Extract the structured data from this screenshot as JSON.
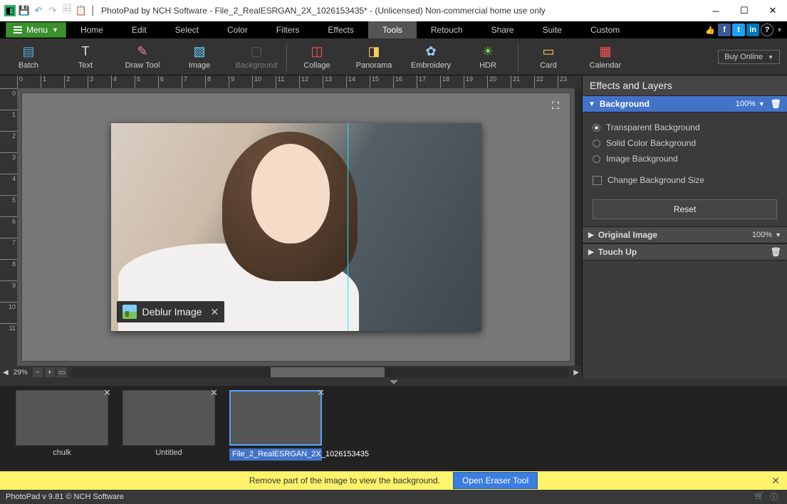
{
  "titlebar": {
    "title": "PhotoPad by NCH Software - File_2_RealESRGAN_2X_1026153435* - (Unlicensed) Non-commercial home use only"
  },
  "menu": {
    "button": "Menu",
    "items": [
      "Home",
      "Edit",
      "Select",
      "Color",
      "Filters",
      "Effects",
      "Tools",
      "Retouch",
      "Share",
      "Suite",
      "Custom"
    ],
    "active_index": 6
  },
  "toolbar": {
    "items": [
      {
        "label": "Batch",
        "icon": "batch-icon",
        "color": "#5ad"
      },
      {
        "label": "Text",
        "icon": "text-icon",
        "color": "#ddd"
      },
      {
        "label": "Draw Tool",
        "icon": "pencil-icon",
        "color": "#e8a"
      },
      {
        "label": "Image",
        "icon": "image-icon",
        "color": "#6cf"
      },
      {
        "label": "Background",
        "icon": "background-icon",
        "color": "#888",
        "disabled": true
      },
      {
        "label": "Collage",
        "icon": "collage-icon",
        "color": "#f55"
      },
      {
        "label": "Panorama",
        "icon": "panorama-icon",
        "color": "#fc5"
      },
      {
        "label": "Embroidery",
        "icon": "embroidery-icon",
        "color": "#9cf"
      },
      {
        "label": "HDR",
        "icon": "hdr-icon",
        "color": "#7d4"
      },
      {
        "label": "Card",
        "icon": "card-icon",
        "color": "#fc5"
      },
      {
        "label": "Calendar",
        "icon": "calendar-icon",
        "color": "#f55"
      }
    ],
    "buy": "Buy Online"
  },
  "canvas": {
    "zoom": "29%",
    "deblur_label": "Deblur Image"
  },
  "panel": {
    "title": "Effects and Layers",
    "sections": {
      "background": {
        "label": "Background",
        "percent": "100%"
      },
      "original": {
        "label": "Original Image",
        "percent": "100%"
      },
      "touchup": {
        "label": "Touch Up"
      }
    },
    "bg_options": {
      "transparent": "Transparent Background",
      "solid": "Solid Color Background",
      "image": "Image Background",
      "change_size": "Change Background Size",
      "reset": "Reset"
    }
  },
  "thumbs": [
    {
      "label": "chulk"
    },
    {
      "label": "Untitled"
    },
    {
      "label": "File_2_RealESRGAN_2X_1026153435"
    }
  ],
  "yellowbar": {
    "msg": "Remove part of the image to view the background.",
    "btn": "Open Eraser Tool"
  },
  "footer": {
    "text": "PhotoPad v 9.81 © NCH Software"
  },
  "ruler_h": [
    "0",
    "1",
    "2",
    "3",
    "4",
    "5",
    "6",
    "7",
    "8",
    "9",
    "10",
    "11",
    "12",
    "13",
    "14",
    "15",
    "16",
    "17",
    "18",
    "19",
    "20",
    "21",
    "22",
    "23"
  ],
  "ruler_v": [
    "0",
    "1",
    "2",
    "3",
    "4",
    "5",
    "6",
    "7",
    "8",
    "9",
    "10",
    "11"
  ]
}
